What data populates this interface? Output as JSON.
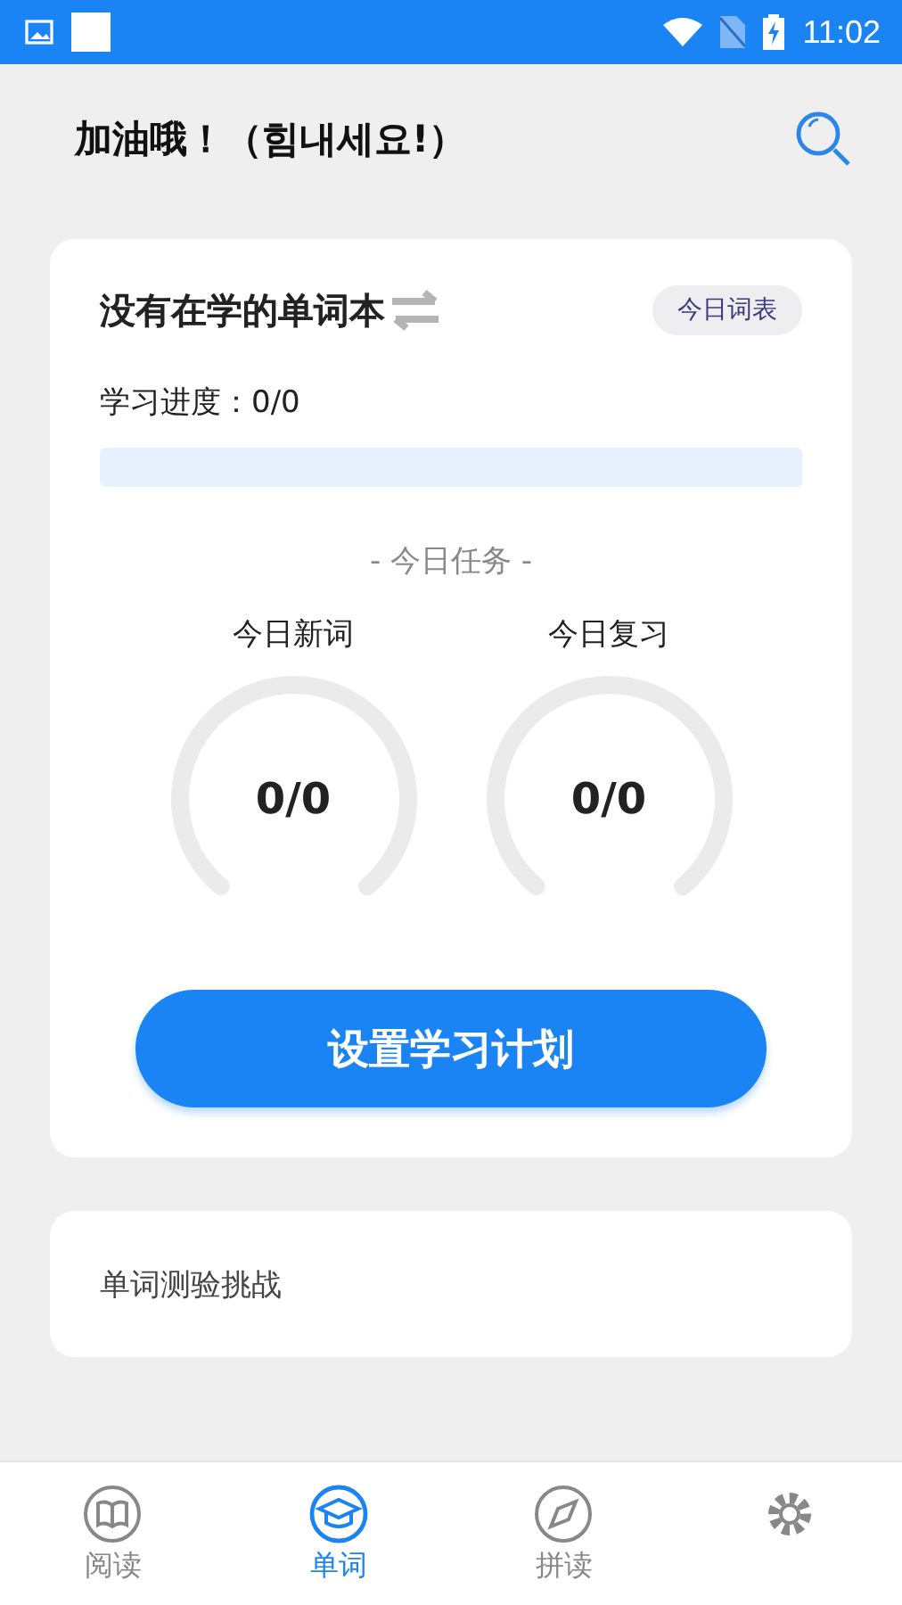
{
  "status_bar": {
    "time": "11:02"
  },
  "header": {
    "title": "加油哦！（힘내세요!）"
  },
  "study_card": {
    "book_title": "没有在学的单词本",
    "word_list_button": "今日词表",
    "progress_label": "学习进度：0/0",
    "progress": {
      "level": 0
    },
    "task_heading": "- 今日任务 -",
    "gauges": [
      {
        "label": "今日新词",
        "value": "0/0"
      },
      {
        "label": "今日复习",
        "value": "0/0"
      }
    ],
    "plan_button": "设置学习计划"
  },
  "quiz_card": {
    "label": "单词测验挑战"
  },
  "tabs": [
    {
      "kind": "book",
      "label": "阅读",
      "selected": false
    },
    {
      "kind": "cap",
      "label": "单词",
      "selected": true
    },
    {
      "kind": "compass",
      "label": "拼读",
      "selected": false
    },
    {
      "kind": "gear",
      "selected": false
    }
  ]
}
